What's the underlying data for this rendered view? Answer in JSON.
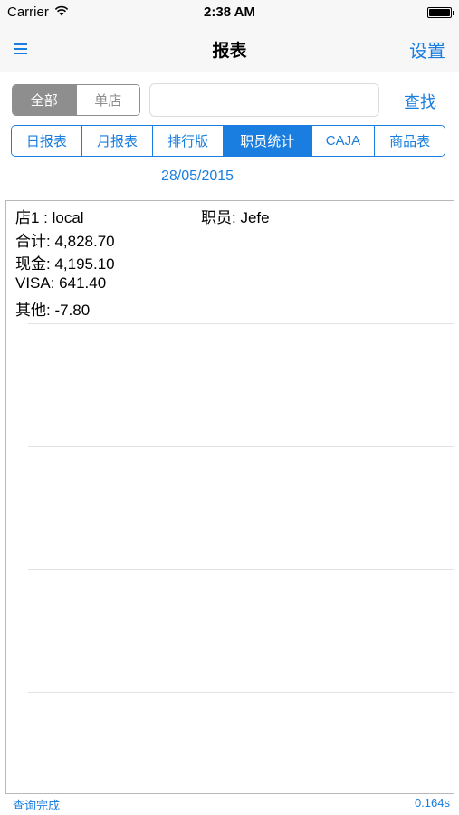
{
  "status_bar": {
    "carrier": "Carrier",
    "time": "2:38 AM",
    "wifi_icon": "wifi-icon",
    "battery_icon": "battery-full-icon"
  },
  "nav": {
    "menu_icon": "hamburger-menu-icon",
    "title": "报表",
    "settings_label": "设置"
  },
  "store_selector": {
    "options": [
      "全部",
      "单店"
    ],
    "selected": "全部"
  },
  "search": {
    "value": "",
    "placeholder": "",
    "button_label": "查找"
  },
  "tabs": {
    "items": [
      "日报表",
      "月报表",
      "排行版",
      "职员统计",
      "CAJA",
      "商品表"
    ],
    "selected": "职员统计"
  },
  "date": "28/05/2015",
  "report": {
    "store": "店1 : local",
    "employee": "职员:  Jefe",
    "lines": [
      "合计:  4,828.70",
      "现金:  4,195.10",
      "VISA:  641.40",
      "其他:  -7.80"
    ]
  },
  "footer": {
    "status": "查询完成",
    "elapsed": "0.164s"
  },
  "colors": {
    "accent": "#1a7ee0",
    "segment_gray": "#8e8e8e",
    "bar_background": "#f7f7f7"
  }
}
